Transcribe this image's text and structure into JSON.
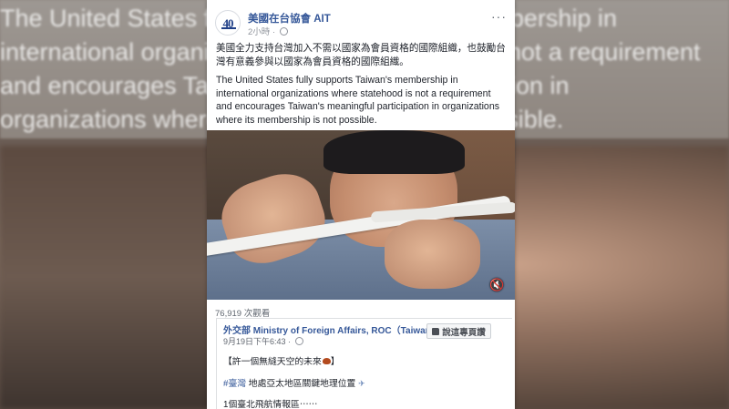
{
  "background": {
    "overlay_lines": [
      "The United States fully supports Taiwan's membership in",
      "international organizations where statehood is not a requirement",
      "and encourages Taiwan's meaningful participation in",
      "organizations where its membership is not possible."
    ]
  },
  "post": {
    "page_name": "美國在台協會 AIT",
    "avatar_mark": "40",
    "time": "2小時 ·",
    "more_label": "···",
    "text_zh": "美國全力支持台灣加入不需以國家為會員資格的國際組織，也鼓勵台灣有意義參與以國家為會員資格的國際組織。",
    "text_en": "The United States fully supports Taiwan's membership in international organizations where statehood is not a requirement and encourages Taiwan's meaningful participation in organizations where its membership is not possible.",
    "views": "76,919 次觀看"
  },
  "shared_post": {
    "name": "外交部 Ministry of Foreign Affairs, ROC（Taiwan）",
    "time": "9月19日下午6:43 ·",
    "follow_label": "說這專頁讚",
    "line1": "【許一個無縫天空的未來",
    "line1_end": "】",
    "hashtag": "#臺灣",
    "line2": " 地處亞太地區關鍵地理位置",
    "line3": "1個臺北飛航情報區⋯⋯"
  },
  "icons": {
    "globe": "globe-icon",
    "more": "more-options-icon",
    "mute": "speaker-muted-icon",
    "like": "thumbs-up-icon"
  },
  "colors": {
    "link_blue": "#365899",
    "text": "#1d2129",
    "meta_gray": "#90949c"
  }
}
